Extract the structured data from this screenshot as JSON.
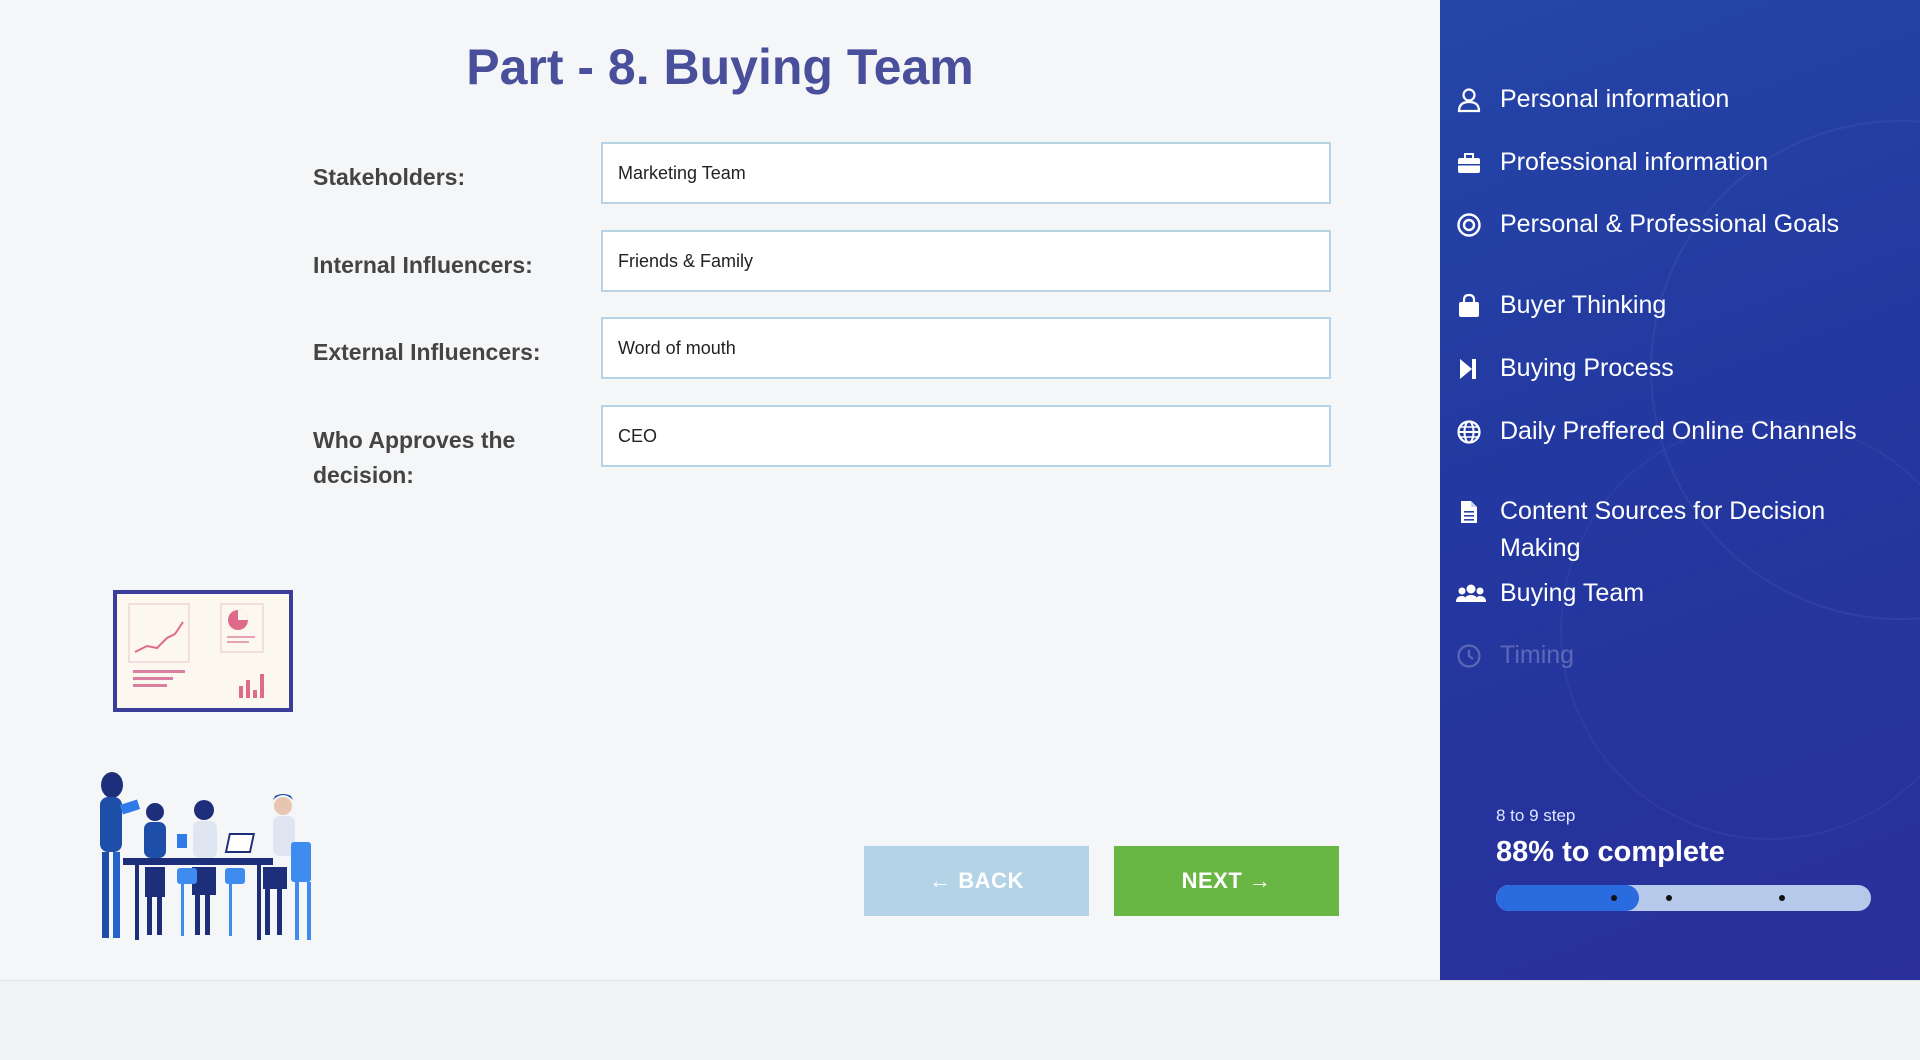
{
  "page": {
    "title": "Part - 8. Buying Team"
  },
  "form": {
    "fields": [
      {
        "label": "Stakeholders:",
        "value": "Marketing Team"
      },
      {
        "label": "Internal Influencers:",
        "value": "Friends & Family"
      },
      {
        "label": "External Influencers:",
        "value": "Word of mouth"
      },
      {
        "label": "Who Approves the decision:",
        "value": "CEO"
      }
    ]
  },
  "buttons": {
    "back": "BACK",
    "next": "NEXT"
  },
  "sidebar": {
    "items": [
      {
        "label": "Personal information",
        "icon": "user-icon"
      },
      {
        "label": "Professional information",
        "icon": "briefcase-icon"
      },
      {
        "label": "Personal & Professional Goals",
        "icon": "target-icon"
      },
      {
        "label": "Buyer Thinking",
        "icon": "shopping-bag-icon"
      },
      {
        "label": "Buying Process",
        "icon": "step-forward-icon"
      },
      {
        "label": "Daily Preffered Online Channels",
        "icon": "globe-icon"
      },
      {
        "label": "Content Sources for Decision Making",
        "icon": "file-icon"
      },
      {
        "label": "Buying Team",
        "icon": "users-icon"
      },
      {
        "label": "Timing",
        "icon": "clock-icon",
        "disabled": true
      }
    ]
  },
  "progress": {
    "step_text": "8 to 9 step",
    "complete_text": "88% to complete",
    "percent": 38,
    "colors": {
      "fill": "#2a6ce0",
      "track": "#b7c9ea"
    }
  },
  "colors": {
    "title": "#4a4f9c",
    "next_button": "#6ab644",
    "back_button": "#b3d3e7",
    "sidebar": "#2338a0"
  }
}
